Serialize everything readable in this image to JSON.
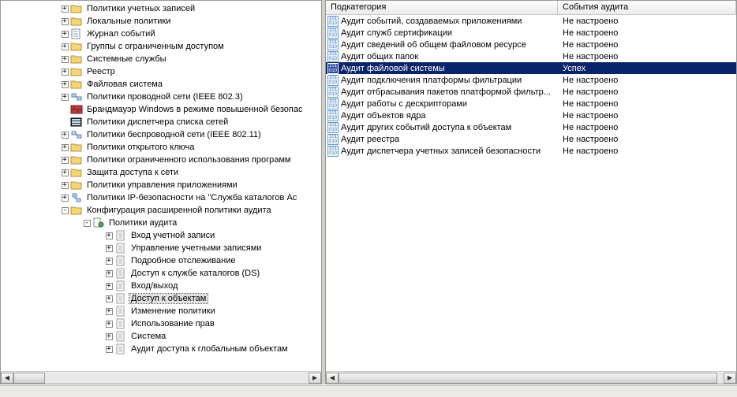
{
  "tree": {
    "nodes": [
      {
        "indent": 5,
        "exp": "+",
        "icon": "folder",
        "label": "Политики учетных записей"
      },
      {
        "indent": 5,
        "exp": "+",
        "icon": "folder",
        "label": "Локальные политики"
      },
      {
        "indent": 5,
        "exp": "+",
        "icon": "eventlog",
        "label": "Журнал событий"
      },
      {
        "indent": 5,
        "exp": "+",
        "icon": "folder-open",
        "label": "Группы с ограниченным доступом"
      },
      {
        "indent": 5,
        "exp": "+",
        "icon": "folder-open",
        "label": "Системные службы"
      },
      {
        "indent": 5,
        "exp": "+",
        "icon": "folder-open",
        "label": "Реестр"
      },
      {
        "indent": 5,
        "exp": "+",
        "icon": "folder-open",
        "label": "Файловая система"
      },
      {
        "indent": 5,
        "exp": "+",
        "icon": "network",
        "label": "Политики проводной сети (IEEE 802.3)"
      },
      {
        "indent": 5,
        "exp": "",
        "icon": "firewall",
        "label": "Брандмауэр Windows в режиме повышенной безопас"
      },
      {
        "indent": 5,
        "exp": "",
        "icon": "listmgr",
        "label": "Политики диспетчера списка сетей"
      },
      {
        "indent": 5,
        "exp": "+",
        "icon": "wireless",
        "label": "Политики беспроводной сети (IEEE 802.11)"
      },
      {
        "indent": 5,
        "exp": "+",
        "icon": "folder",
        "label": "Политики открытого ключа"
      },
      {
        "indent": 5,
        "exp": "+",
        "icon": "folder",
        "label": "Политики ограниченного использования программ"
      },
      {
        "indent": 5,
        "exp": "+",
        "icon": "folder",
        "label": "Защита доступа к сети"
      },
      {
        "indent": 5,
        "exp": "+",
        "icon": "folder",
        "label": "Политики управления приложениями"
      },
      {
        "indent": 5,
        "exp": "+",
        "icon": "ipsec",
        "label": "Политики IP-безопасности на \"Служба каталогов Ac"
      },
      {
        "indent": 5,
        "exp": "-",
        "icon": "folder",
        "label": "Конфигурация расширенной политики аудита"
      },
      {
        "indent": 7,
        "exp": "-",
        "icon": "audit",
        "label": "Политики аудита"
      },
      {
        "indent": 9,
        "exp": "+",
        "icon": "page",
        "label": "Вход учетной записи"
      },
      {
        "indent": 9,
        "exp": "+",
        "icon": "page",
        "label": "Управление учетными записями"
      },
      {
        "indent": 9,
        "exp": "+",
        "icon": "page",
        "label": "Подробное отслеживание"
      },
      {
        "indent": 9,
        "exp": "+",
        "icon": "page",
        "label": "Доступ к службе каталогов (DS)"
      },
      {
        "indent": 9,
        "exp": "+",
        "icon": "page",
        "label": "Вход/выход"
      },
      {
        "indent": 9,
        "exp": "+",
        "icon": "page",
        "label": "Доступ к объектам",
        "selected": true
      },
      {
        "indent": 9,
        "exp": "+",
        "icon": "page",
        "label": "Изменение политики"
      },
      {
        "indent": 9,
        "exp": "+",
        "icon": "page",
        "label": "Использование прав"
      },
      {
        "indent": 9,
        "exp": "+",
        "icon": "page",
        "label": "Система"
      },
      {
        "indent": 9,
        "exp": "+",
        "icon": "page",
        "label": "Аудит доступа к глобальным объектам"
      }
    ]
  },
  "list": {
    "header": {
      "sub": "Подкатегория",
      "ev": "События аудита"
    },
    "rows": [
      {
        "sub": "Аудит событий, создаваемых приложениями",
        "ev": "Не настроено"
      },
      {
        "sub": "Аудит служб сертификации",
        "ev": "Не настроено"
      },
      {
        "sub": "Аудит сведений об общем файловом ресурсе",
        "ev": "Не настроено"
      },
      {
        "sub": "Аудит общих папок",
        "ev": "Не настроено"
      },
      {
        "sub": "Аудит файловой системы",
        "ev": "Успех",
        "selected": true
      },
      {
        "sub": "Аудит подключения платформы фильтрации",
        "ev": "Не настроено"
      },
      {
        "sub": "Аудит отбрасывания пакетов платформой фильтр...",
        "ev": "Не настроено"
      },
      {
        "sub": "Аудит работы с дескрипторами",
        "ev": "Не настроено"
      },
      {
        "sub": "Аудит объектов ядра",
        "ev": "Не настроено"
      },
      {
        "sub": "Аудит других событий доступа к объектам",
        "ev": "Не настроено"
      },
      {
        "sub": "Аудит реестра",
        "ev": "Не настроено"
      },
      {
        "sub": "Аудит диспетчера учетных записей безопасности",
        "ev": "Не настроено"
      }
    ]
  }
}
